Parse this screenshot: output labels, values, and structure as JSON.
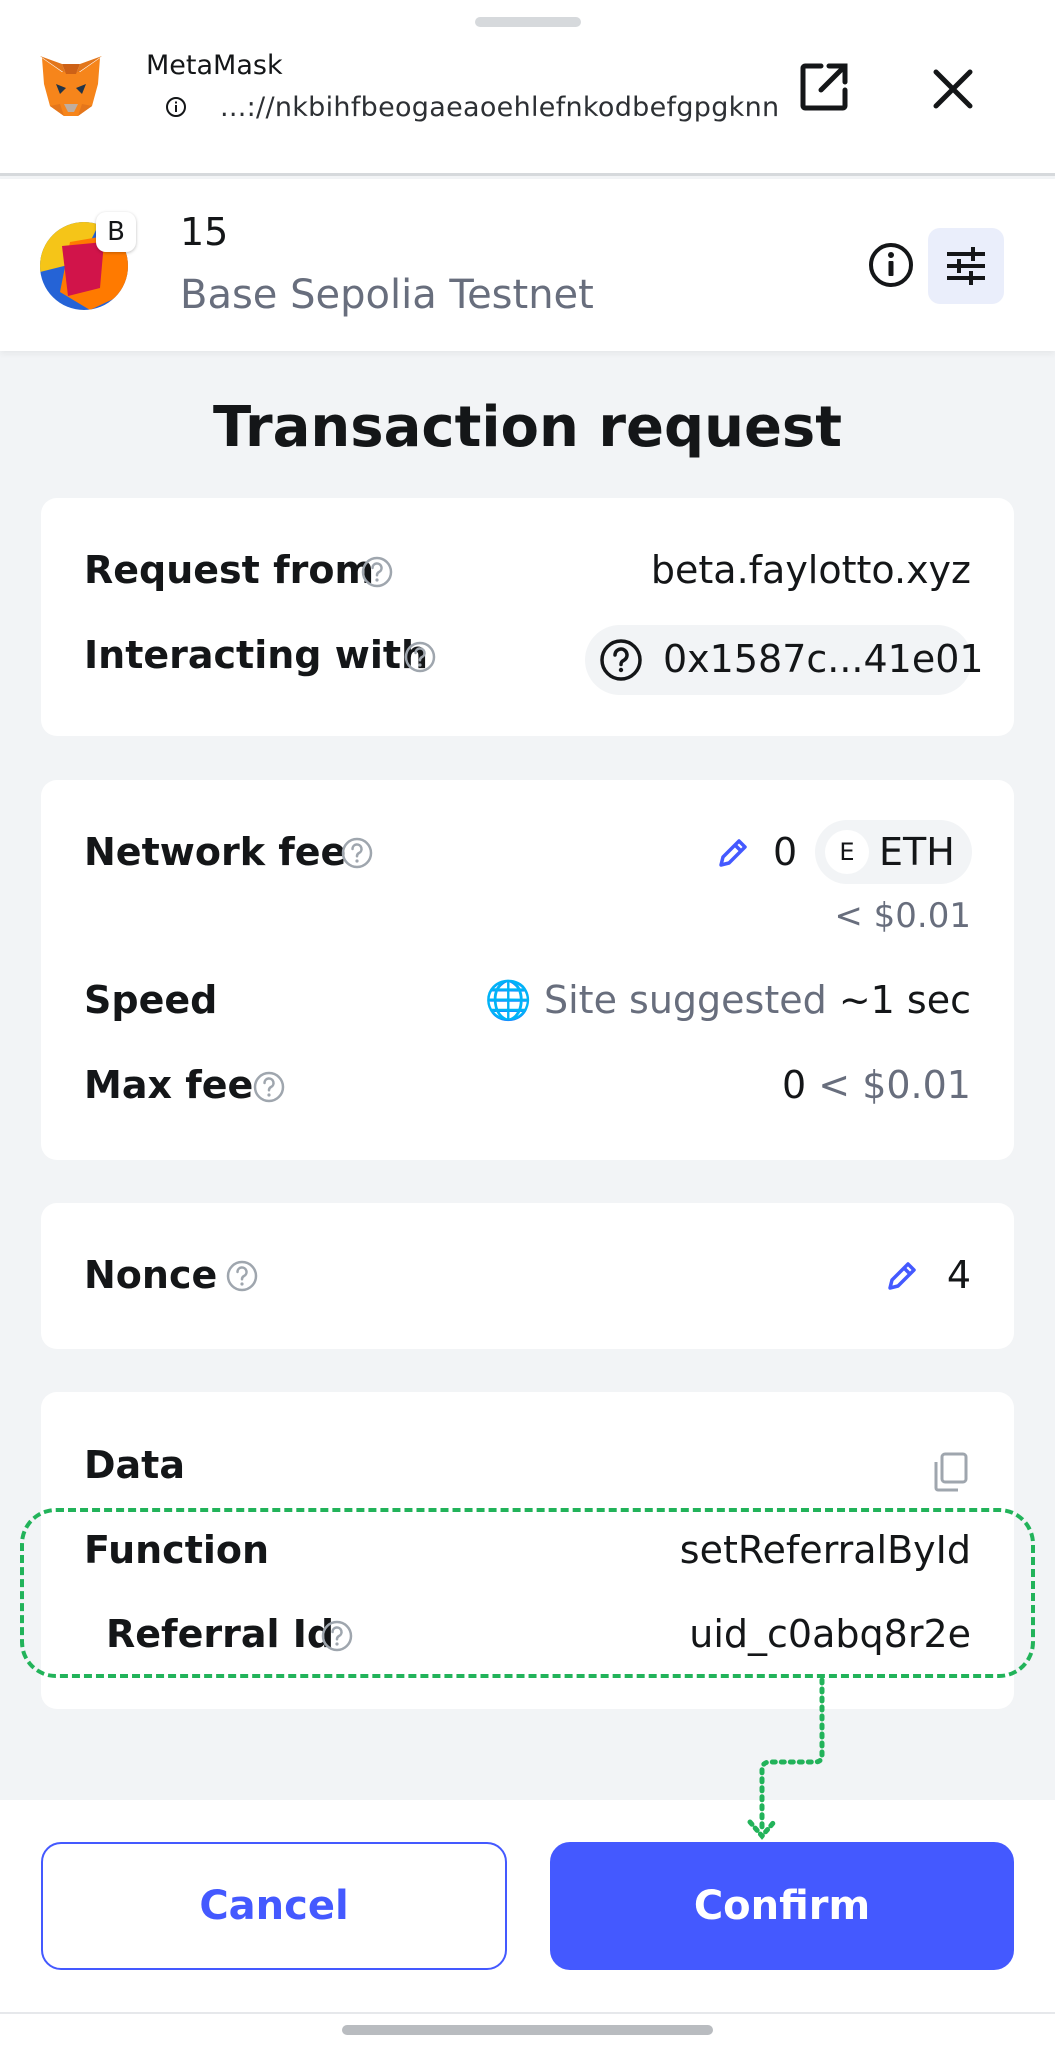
{
  "header": {
    "app_name": "MetaMask",
    "url": "...://nkbihfbeogaeaoehlefnkodbefgpgknn",
    "icons": [
      "metamask-fox-icon",
      "site-info-icon",
      "open-external-icon",
      "close-icon"
    ]
  },
  "account": {
    "name": "15",
    "network": "Base Sepolia Testnet",
    "network_badge": "B",
    "icons": [
      "info-icon",
      "settings-sliders-icon"
    ]
  },
  "page": {
    "title": "Transaction request"
  },
  "request_card": {
    "request_from_label": "Request from",
    "request_from_value": "beta.faylotto.xyz",
    "interacting_label": "Interacting with",
    "interacting_value": "0x1587c...41e01"
  },
  "fee_card": {
    "network_fee_label": "Network fee",
    "network_fee_amount": "0",
    "network_fee_token_badge": "E",
    "network_fee_token": "ETH",
    "network_fee_fiat": "< $0.01",
    "speed_label": "Speed",
    "speed_source": "🌐 Site suggested",
    "speed_time": "~1 sec",
    "max_fee_label": "Max fee",
    "max_fee_amount": "0",
    "max_fee_fiat": "< $0.01"
  },
  "nonce_card": {
    "nonce_label": "Nonce",
    "nonce_value": "4"
  },
  "data_card": {
    "data_label": "Data",
    "function_label": "Function",
    "function_value": "setReferralById",
    "param_label": "Referral Id",
    "param_value": "uid_c0abq8r2e"
  },
  "footer": {
    "cancel_label": "Cancel",
    "confirm_label": "Confirm"
  },
  "colors": {
    "accent": "#4459ff",
    "annotation": "#22b35a",
    "muted_text": "#686e7d",
    "background": "#f2f4f6"
  }
}
